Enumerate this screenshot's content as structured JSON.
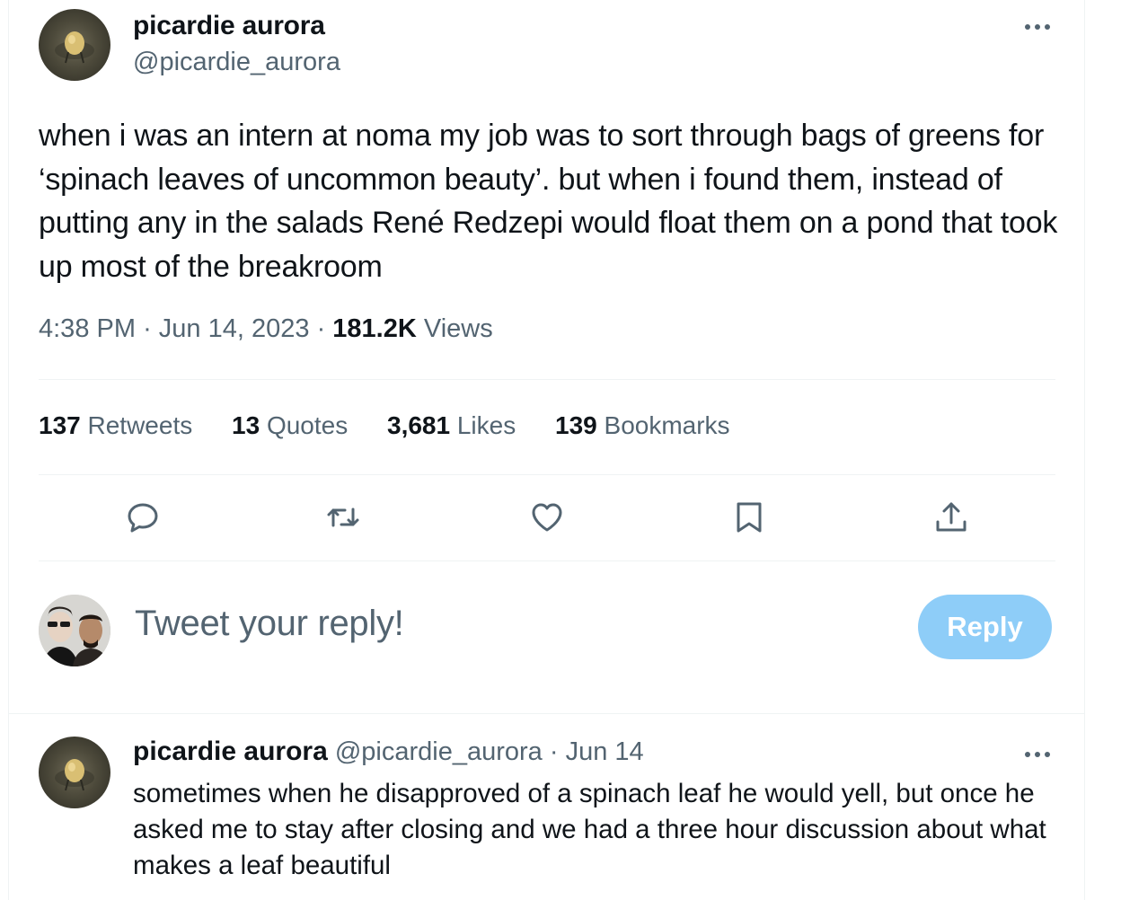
{
  "tweet": {
    "author_name": "picardie aurora",
    "author_handle": "@picardie_aurora",
    "text": "when i was an intern at noma my job was to sort through bags of greens for ‘spinach leaves of uncommon beauty’. but when i found them, instead of putting any in the salads René Redzepi would float them on a pond that took up most of the breakroom",
    "time": "4:38 PM",
    "date": "Jun 14, 2023",
    "views_count": "181.2K",
    "views_label": "Views",
    "separator": "·"
  },
  "stats": [
    {
      "count": "137",
      "label": "Retweets"
    },
    {
      "count": "13",
      "label": "Quotes"
    },
    {
      "count": "3,681",
      "label": "Likes"
    },
    {
      "count": "139",
      "label": "Bookmarks"
    }
  ],
  "actions": [
    "reply-icon",
    "retweet-icon",
    "like-icon",
    "bookmark-icon",
    "share-icon"
  ],
  "composer": {
    "placeholder": "Tweet your reply!",
    "button_label": "Reply"
  },
  "reply": {
    "author_name": "picardie aurora",
    "author_handle": "@picardie_aurora",
    "separator": "·",
    "date": "Jun 14",
    "text": "sometimes when he disapproved of a spinach leaf he would yell, but once he asked me to stay after closing and we had a three hour discussion about what makes a leaf beautiful"
  },
  "colors": {
    "text_primary": "#0f1419",
    "text_secondary": "#536471",
    "divider": "#eff3f4",
    "reply_button_disabled": "#8ecdf8"
  }
}
